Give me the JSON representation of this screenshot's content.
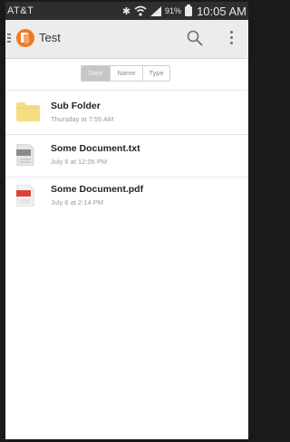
{
  "status_bar": {
    "carrier": "AT&T",
    "battery_percent": "91%",
    "time": "10:05 AM"
  },
  "toolbar": {
    "title": "Test",
    "icons": [
      "hamburger-icon",
      "app-icon",
      "search-icon",
      "overflow-menu-icon"
    ]
  },
  "sort": {
    "options": [
      "Date",
      "Name",
      "Type"
    ],
    "selected": "Date"
  },
  "files": [
    {
      "name": "Sub Folder",
      "meta": "Thursday at 7:55 AM",
      "icon": "folder-icon"
    },
    {
      "name": "Some Document.txt",
      "meta": "July 6 at 12:05 PM",
      "icon": "txt-file-icon"
    },
    {
      "name": "Some Document.pdf",
      "meta": "July 6 at 2:14 PM",
      "icon": "pdf-file-icon"
    }
  ],
  "colors": {
    "accent": "#f07a22",
    "pdf_red": "#e0403a",
    "folder": "#f5dd82",
    "status_bar": "#2e2e2e",
    "toolbar": "#ececec"
  }
}
